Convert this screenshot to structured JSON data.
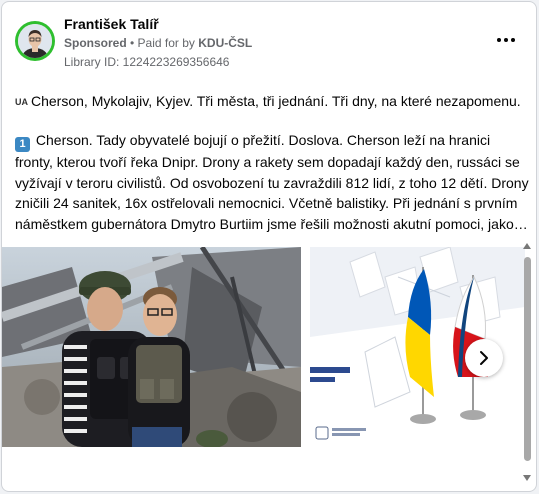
{
  "post": {
    "author": "František Talíř",
    "sponsored": "Sponsored",
    "paid_for_prefix": " • Paid for by ",
    "paid_by": "KDU-ČSL",
    "library_id": "Library ID: 1224223269356646",
    "flag_code": "UA",
    "paragraph1": "Cherson, Mykolajiv, Kyjev. Tři města, tři jednání. Tři dny, na které nezapomenu.",
    "keycap": "1",
    "paragraph2": "Cherson. Tady obyvatelé bojují o přežití. Doslova. Cherson leží na hranici fronty, kterou tvoří řeka Dnipr. Drony a rakety sem dopadají každý den, russáci se vyžívají v teroru civilistů. Od osvobození tu zavraždili 812 lidí, z toho 12 dětí. Drony zničili 24 sanitek, 16x ostřelovali nemocnici. Včetně balistiky. Při jednání s prvním náměstkem gubernátora Dmytro Burtiim jsme řešili možnosti akutní pomoci, jako…"
  },
  "icons": {
    "more": "more-horizontal-icon",
    "next": "chevron-right-icon"
  },
  "colors": {
    "avatar_ring": "#2fbf2f",
    "keycap": "#3b88c3",
    "ua_blue": "#0057b7",
    "ua_yellow": "#ffd700",
    "cz_red": "#d7141a",
    "cz_blue": "#11457e"
  }
}
